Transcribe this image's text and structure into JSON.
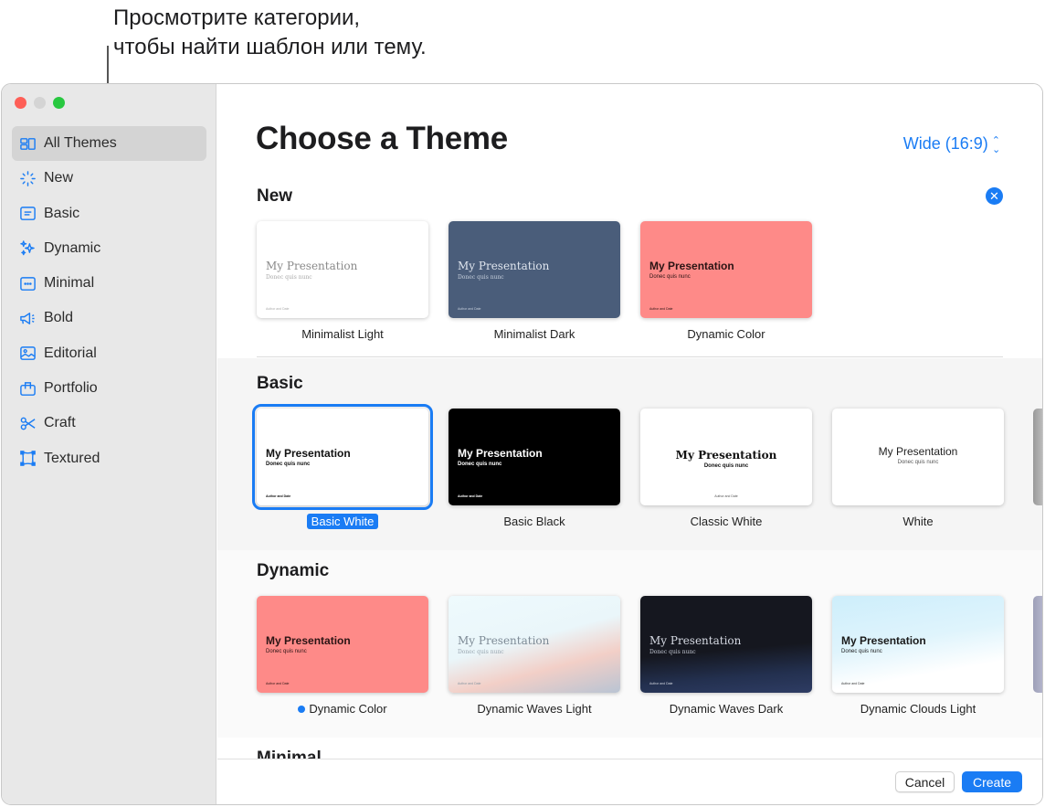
{
  "callout": {
    "line1": "Просмотрите категории,",
    "line2": "чтобы найти шаблон или тему."
  },
  "sidebar": {
    "items": [
      {
        "label": "All Themes",
        "icon": "grid-icon",
        "active": true
      },
      {
        "label": "New",
        "icon": "sparkle-burst-icon"
      },
      {
        "label": "Basic",
        "icon": "basic-slide-icon"
      },
      {
        "label": "Dynamic",
        "icon": "sparkles-icon"
      },
      {
        "label": "Minimal",
        "icon": "ellipsis-slide-icon"
      },
      {
        "label": "Bold",
        "icon": "megaphone-icon"
      },
      {
        "label": "Editorial",
        "icon": "photo-icon"
      },
      {
        "label": "Portfolio",
        "icon": "briefcase-icon"
      },
      {
        "label": "Craft",
        "icon": "scissors-icon"
      },
      {
        "label": "Textured",
        "icon": "textured-frame-icon"
      }
    ]
  },
  "header": {
    "title": "Choose a Theme",
    "size_select": "Wide (16:9)"
  },
  "sections": [
    {
      "title": "New",
      "cards": [
        {
          "label": "Minimalist Light",
          "t1": "My Presentation",
          "t2": "Donec quis nunc",
          "t3": "Author and Date"
        },
        {
          "label": "Minimalist Dark",
          "t1": "My Presentation",
          "t2": "Donec quis nunc",
          "t3": "Author and Date"
        },
        {
          "label": "Dynamic Color",
          "t1": "My Presentation",
          "t2": "Donec quis nunc",
          "t3": "Author and Date"
        }
      ]
    },
    {
      "title": "Basic",
      "cards": [
        {
          "label": "Basic White",
          "t1": "My Presentation",
          "t2": "Donec quis nunc",
          "t3": "Author and Date",
          "selected": true
        },
        {
          "label": "Basic Black",
          "t1": "My Presentation",
          "t2": "Donec quis nunc",
          "t3": "Author and Date"
        },
        {
          "label": "Classic White",
          "t1": "My Presentation",
          "t2": "Donec quis nunc",
          "t3": "Author and Date"
        },
        {
          "label": "White",
          "t1": "My Presentation",
          "t2": "Donec quis nunc"
        }
      ]
    },
    {
      "title": "Dynamic",
      "cards": [
        {
          "label": "Dynamic Color",
          "t1": "My Presentation",
          "t2": "Donec quis nunc",
          "t3": "Author and Date",
          "dot": true
        },
        {
          "label": "Dynamic Waves Light",
          "t1": "My Presentation",
          "t2": "Donec quis nunc",
          "t3": "Author and Date"
        },
        {
          "label": "Dynamic Waves Dark",
          "t1": "My Presentation",
          "t2": "Donec quis nunc",
          "t3": "Author and Date"
        },
        {
          "label": "Dynamic Clouds Light",
          "t1": "My Presentation",
          "t2": "Donec quis nunc",
          "t3": "Author and Date"
        }
      ]
    },
    {
      "title": "Minimal"
    }
  ],
  "footer": {
    "cancel": "Cancel",
    "create": "Create"
  },
  "colors": {
    "accent": "#1a7cf4",
    "minimalist_dark": "#4a5d7a",
    "dynamic_color": "#fe8a88",
    "waves_dark": "#15171f"
  }
}
